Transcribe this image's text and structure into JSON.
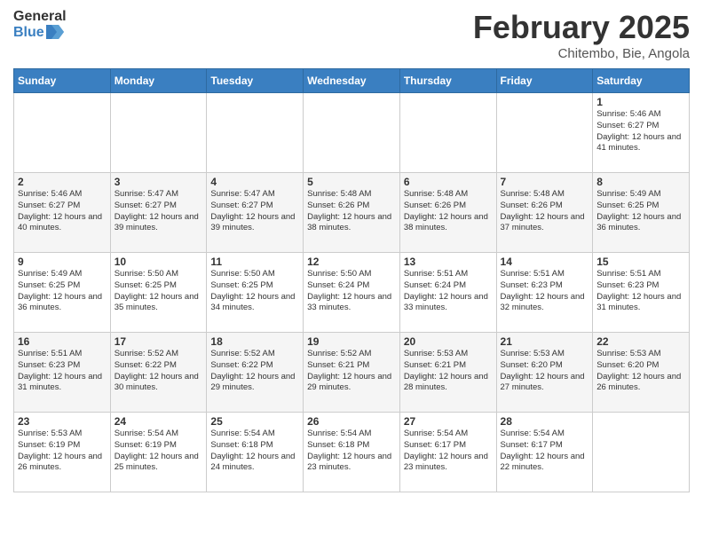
{
  "header": {
    "logo_line1": "General",
    "logo_line2": "Blue",
    "month": "February 2025",
    "location": "Chitembo, Bie, Angola"
  },
  "weekdays": [
    "Sunday",
    "Monday",
    "Tuesday",
    "Wednesday",
    "Thursday",
    "Friday",
    "Saturday"
  ],
  "weeks": [
    [
      {
        "day": "",
        "info": ""
      },
      {
        "day": "",
        "info": ""
      },
      {
        "day": "",
        "info": ""
      },
      {
        "day": "",
        "info": ""
      },
      {
        "day": "",
        "info": ""
      },
      {
        "day": "",
        "info": ""
      },
      {
        "day": "1",
        "info": "Sunrise: 5:46 AM\nSunset: 6:27 PM\nDaylight: 12 hours and 41 minutes."
      }
    ],
    [
      {
        "day": "2",
        "info": "Sunrise: 5:46 AM\nSunset: 6:27 PM\nDaylight: 12 hours and 40 minutes."
      },
      {
        "day": "3",
        "info": "Sunrise: 5:47 AM\nSunset: 6:27 PM\nDaylight: 12 hours and 39 minutes."
      },
      {
        "day": "4",
        "info": "Sunrise: 5:47 AM\nSunset: 6:27 PM\nDaylight: 12 hours and 39 minutes."
      },
      {
        "day": "5",
        "info": "Sunrise: 5:48 AM\nSunset: 6:26 PM\nDaylight: 12 hours and 38 minutes."
      },
      {
        "day": "6",
        "info": "Sunrise: 5:48 AM\nSunset: 6:26 PM\nDaylight: 12 hours and 38 minutes."
      },
      {
        "day": "7",
        "info": "Sunrise: 5:48 AM\nSunset: 6:26 PM\nDaylight: 12 hours and 37 minutes."
      },
      {
        "day": "8",
        "info": "Sunrise: 5:49 AM\nSunset: 6:25 PM\nDaylight: 12 hours and 36 minutes."
      }
    ],
    [
      {
        "day": "9",
        "info": "Sunrise: 5:49 AM\nSunset: 6:25 PM\nDaylight: 12 hours and 36 minutes."
      },
      {
        "day": "10",
        "info": "Sunrise: 5:50 AM\nSunset: 6:25 PM\nDaylight: 12 hours and 35 minutes."
      },
      {
        "day": "11",
        "info": "Sunrise: 5:50 AM\nSunset: 6:25 PM\nDaylight: 12 hours and 34 minutes."
      },
      {
        "day": "12",
        "info": "Sunrise: 5:50 AM\nSunset: 6:24 PM\nDaylight: 12 hours and 33 minutes."
      },
      {
        "day": "13",
        "info": "Sunrise: 5:51 AM\nSunset: 6:24 PM\nDaylight: 12 hours and 33 minutes."
      },
      {
        "day": "14",
        "info": "Sunrise: 5:51 AM\nSunset: 6:23 PM\nDaylight: 12 hours and 32 minutes."
      },
      {
        "day": "15",
        "info": "Sunrise: 5:51 AM\nSunset: 6:23 PM\nDaylight: 12 hours and 31 minutes."
      }
    ],
    [
      {
        "day": "16",
        "info": "Sunrise: 5:51 AM\nSunset: 6:23 PM\nDaylight: 12 hours and 31 minutes."
      },
      {
        "day": "17",
        "info": "Sunrise: 5:52 AM\nSunset: 6:22 PM\nDaylight: 12 hours and 30 minutes."
      },
      {
        "day": "18",
        "info": "Sunrise: 5:52 AM\nSunset: 6:22 PM\nDaylight: 12 hours and 29 minutes."
      },
      {
        "day": "19",
        "info": "Sunrise: 5:52 AM\nSunset: 6:21 PM\nDaylight: 12 hours and 29 minutes."
      },
      {
        "day": "20",
        "info": "Sunrise: 5:53 AM\nSunset: 6:21 PM\nDaylight: 12 hours and 28 minutes."
      },
      {
        "day": "21",
        "info": "Sunrise: 5:53 AM\nSunset: 6:20 PM\nDaylight: 12 hours and 27 minutes."
      },
      {
        "day": "22",
        "info": "Sunrise: 5:53 AM\nSunset: 6:20 PM\nDaylight: 12 hours and 26 minutes."
      }
    ],
    [
      {
        "day": "23",
        "info": "Sunrise: 5:53 AM\nSunset: 6:19 PM\nDaylight: 12 hours and 26 minutes."
      },
      {
        "day": "24",
        "info": "Sunrise: 5:54 AM\nSunset: 6:19 PM\nDaylight: 12 hours and 25 minutes."
      },
      {
        "day": "25",
        "info": "Sunrise: 5:54 AM\nSunset: 6:18 PM\nDaylight: 12 hours and 24 minutes."
      },
      {
        "day": "26",
        "info": "Sunrise: 5:54 AM\nSunset: 6:18 PM\nDaylight: 12 hours and 23 minutes."
      },
      {
        "day": "27",
        "info": "Sunrise: 5:54 AM\nSunset: 6:17 PM\nDaylight: 12 hours and 23 minutes."
      },
      {
        "day": "28",
        "info": "Sunrise: 5:54 AM\nSunset: 6:17 PM\nDaylight: 12 hours and 22 minutes."
      },
      {
        "day": "",
        "info": ""
      }
    ]
  ]
}
